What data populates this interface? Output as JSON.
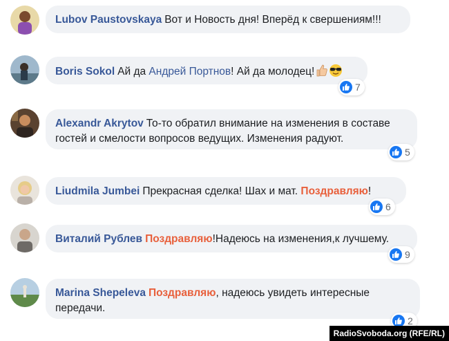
{
  "comments": [
    {
      "author": "Lubov Paustovskaya",
      "text": "Вот и Новость дня! Вперёд к свершениям!!!"
    },
    {
      "author": "Boris Sokol",
      "text_before": "Ай да ",
      "mention": "Андрей Портнов",
      "text_after": "! Ай да молодец!",
      "likes": "7",
      "emoji": [
        "thumbs-up-emoji",
        "sunglasses-emoji"
      ]
    },
    {
      "author": "Alexandr Akrytov",
      "line1": "То-то обратил внимание на изменения в составе",
      "line2": "гостей и смелости вопросов ведущих. Изменения радуют.",
      "likes": "5"
    },
    {
      "author": "Liudmila Jumbei",
      "text_before": "Прекрасная сделка! Шах и мат. ",
      "highlight": "Поздравляю",
      "text_after": "!",
      "likes": "6"
    },
    {
      "author": "Виталий Рублев",
      "highlight": "Поздравляю",
      "text_after": "!Надеюсь на изменения,к лучшему.",
      "likes": "9"
    },
    {
      "author": "Marina Shepeleva",
      "highlight": "Поздравляю",
      "line1_after": ", надеюсь увидеть интересные",
      "line2": "передачи.",
      "likes": "2"
    }
  ],
  "credit": "RadioSvoboda.org (RFE/RL)",
  "colors": {
    "author": "#385898",
    "highlight": "#e8603c",
    "bubble": "#f0f2f5",
    "like": "#1877f2"
  }
}
